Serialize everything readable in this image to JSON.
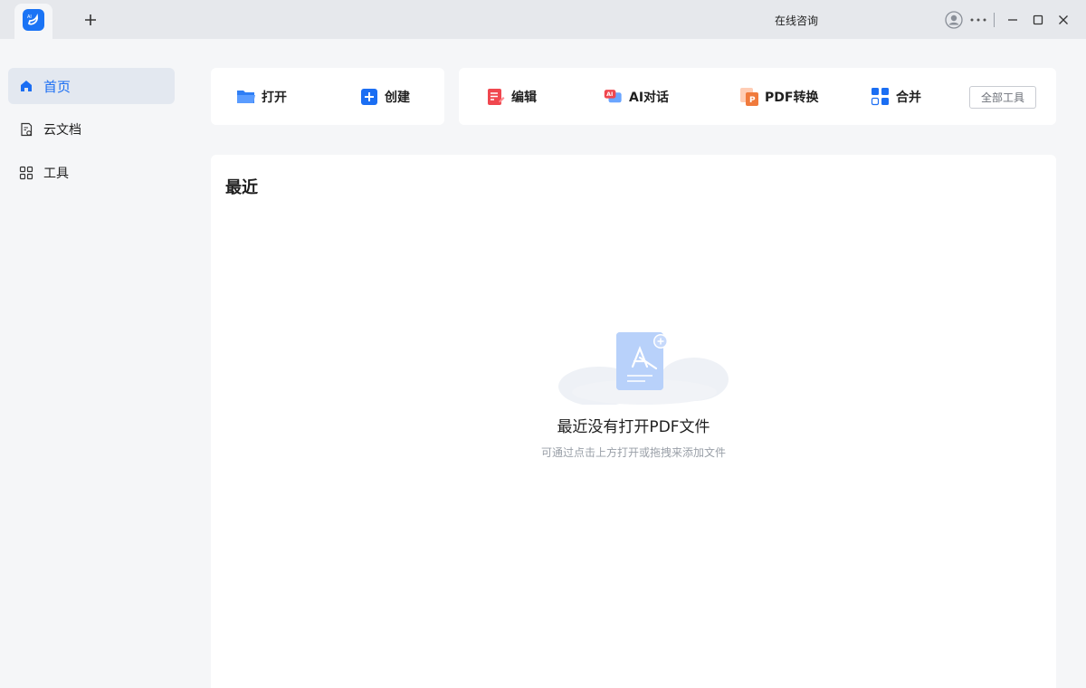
{
  "titlebar": {
    "app_icon": "app-logo-icon",
    "new_tab_icon": "plus-icon",
    "consult_label": "在线咨询",
    "icons": [
      "account-icon",
      "more-icon",
      "minimize-icon",
      "maximize-icon",
      "close-icon"
    ]
  },
  "sidebar": {
    "items": [
      {
        "label": "首页",
        "icon": "home-icon",
        "active": true
      },
      {
        "label": "云文档",
        "icon": "cloud-doc-icon",
        "active": false
      },
      {
        "label": "工具",
        "icon": "tools-grid-icon",
        "active": false
      }
    ]
  },
  "quick_actions": {
    "open_label": "打开",
    "create_label": "创建"
  },
  "toolbar": {
    "edit_label": "编辑",
    "ai_chat_label": "AI对话",
    "ai_badge": "AI",
    "pdf_convert_label": "PDF转换",
    "pdf_badge": "P",
    "merge_label": "合并",
    "all_tools_label": "全部工具"
  },
  "recent": {
    "title": "最近",
    "empty_title": "最近没有打开PDF文件",
    "empty_subtitle": "可通过点击上方打开或拖拽来添加文件"
  },
  "colors": {
    "accent": "#1b6ef3",
    "edit_red": "#f0474f",
    "convert_orange": "#f07a3c",
    "background": "#f5f6f8",
    "card": "#ffffff"
  }
}
